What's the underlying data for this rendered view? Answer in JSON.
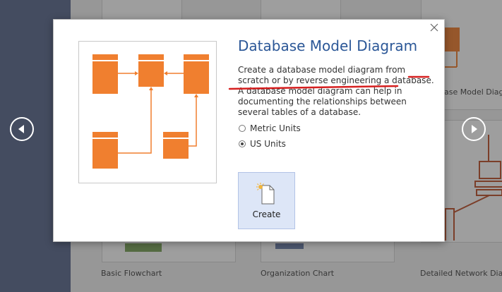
{
  "gallery": {
    "cards": [
      {
        "label": "Basic Flowchart"
      },
      {
        "label": "Organization Chart"
      },
      {
        "label": "Detailed Network Diag"
      },
      {
        "label": "ase Model Diagr"
      }
    ]
  },
  "dialog": {
    "title": "Database Model Diagram",
    "description": "Create a database model diagram from scratch or by reverse engineering a database. A database model diagram can help in documenting the relationships between several tables of a database.",
    "units": [
      {
        "label": "Metric Units",
        "selected": false
      },
      {
        "label": "US Units",
        "selected": true
      }
    ],
    "create_label": "Create"
  },
  "icons": {
    "close": "close-icon",
    "prev": "chevron-left-circle-icon",
    "next": "chevron-right-circle-icon",
    "new_document": "new-document-icon"
  },
  "colors": {
    "accent_title": "#2b5797",
    "diagram_orange": "#f07f2f",
    "annotation_red": "#d61f1f",
    "create_bg": "#dde6f7",
    "left_strip": "#5b6b8f"
  }
}
